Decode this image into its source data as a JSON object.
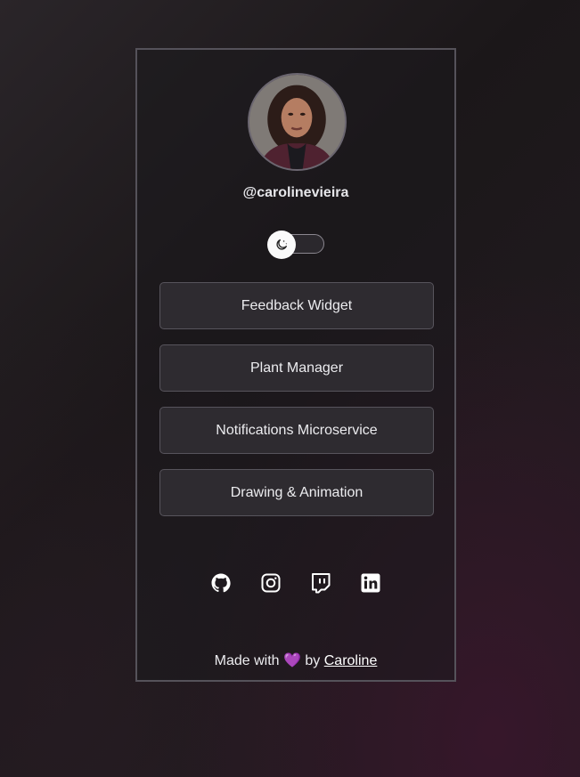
{
  "profile": {
    "username": "@carolinevieira",
    "avatar_alt": "Caroline Vieira"
  },
  "theme_toggle": {
    "icon": "moon-icon",
    "state": "dark"
  },
  "links": [
    {
      "label": "Feedback Widget"
    },
    {
      "label": "Plant Manager"
    },
    {
      "label": "Notifications Microservice"
    },
    {
      "label": "Drawing & Animation"
    }
  ],
  "socials": [
    {
      "icon": "github-icon"
    },
    {
      "icon": "instagram-icon"
    },
    {
      "icon": "twitch-icon"
    },
    {
      "icon": "linkedin-icon"
    }
  ],
  "footer": {
    "prefix": "Made with",
    "heart": "💜",
    "by": "by",
    "author": "Caroline"
  },
  "colors": {
    "background": "#1e1a1d",
    "card_border": "#55525a",
    "button_bg": "#2e2b30",
    "heart": "#b46cff"
  }
}
